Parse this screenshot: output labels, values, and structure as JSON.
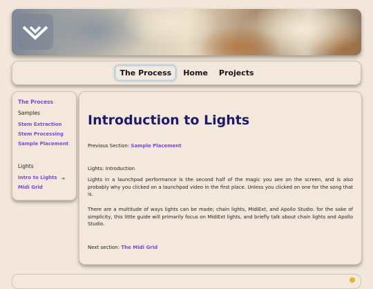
{
  "nav": {
    "items": [
      {
        "label": "The Process",
        "active": true
      },
      {
        "label": "Home",
        "active": false
      },
      {
        "label": "Projects",
        "active": false
      }
    ]
  },
  "sidebar": {
    "top_link": "The Process",
    "samples_heading": "Samples",
    "samples_links": [
      "Stem Extraction",
      "Stem Processing",
      "Sample Placement"
    ],
    "lights_heading": "Lights",
    "lights_links": [
      "Intro to Lights",
      "Midi Grid"
    ],
    "current_indicator": "◄"
  },
  "main": {
    "title": "Introduction to Lights",
    "prev_label": "Previous Section:",
    "prev_link": "Sample Placement",
    "subheading": "Lights: Introduction",
    "paragraph1": "Lights in a launchpad performance is the second half of the magic you see on the screen, and is also probably why you clicked on a launchpad video in the first place. Unless you clicked on one for the song that is.",
    "paragraph2": "There are a multitude of ways lights can be made; chain lights, MidiExt, and Apollo Studio. for the sake of simplicity, this little guide will primarily focus on MidiExt lights, and briefly talk about chain lights and Apollo Studio.",
    "next_label": "Next section:",
    "next_link": "The Midi Grid"
  },
  "colors": {
    "background": "#f2e7da",
    "link": "#7a47d9",
    "title": "#1c1a6b"
  }
}
